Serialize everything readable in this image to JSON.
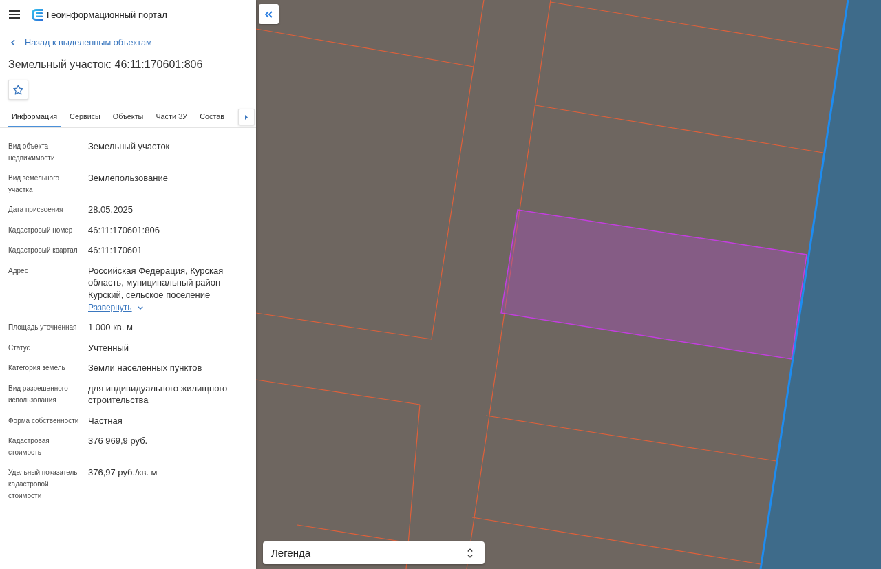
{
  "header": {
    "title": "Геоинформационный портал"
  },
  "back_link": {
    "label": "Назад к выделенным объектам"
  },
  "object": {
    "title": "Земельный участок: 46:11:170601:806"
  },
  "tabs": [
    {
      "label": "Информация",
      "selected": true
    },
    {
      "label": "Сервисы",
      "selected": false
    },
    {
      "label": "Объекты",
      "selected": false
    },
    {
      "label": "Части ЗУ",
      "selected": false
    },
    {
      "label": "Состав",
      "selected": false
    }
  ],
  "fields": [
    {
      "label": "Вид объекта недвижимости",
      "value": "Земельный участок"
    },
    {
      "label": "Вид земельного участка",
      "value": "Землепользование"
    },
    {
      "label": "Дата присвоения",
      "value": "28.05.2025"
    },
    {
      "label": "Кадастровый номер",
      "value": "46:11:170601:806"
    },
    {
      "label": "Кадастровый квартал",
      "value": "46:11:170601"
    },
    {
      "label": "Адрес",
      "value": "Российская Федерация, Курская область, муниципальный район Курский, сельское поселение",
      "expand_link": "Развернуть"
    },
    {
      "label": "Площадь уточненная",
      "value": "1 000 кв. м"
    },
    {
      "label": "Статус",
      "value": "Учтенный"
    },
    {
      "label": "Категория земель",
      "value": "Земли населенных пунктов"
    },
    {
      "label": "Вид разрешенного использования",
      "value": "для индивидуального жилищного строительства"
    },
    {
      "label": "Форма собственности",
      "value": "Частная"
    },
    {
      "label": "Кадастровая стоимость",
      "value": "376 969,9 руб."
    },
    {
      "label": "Удельный показатель кадастровой стоимости",
      "value": "376,97 руб./кв. м"
    }
  ],
  "map": {
    "legend": {
      "label": "Легенда"
    }
  }
}
